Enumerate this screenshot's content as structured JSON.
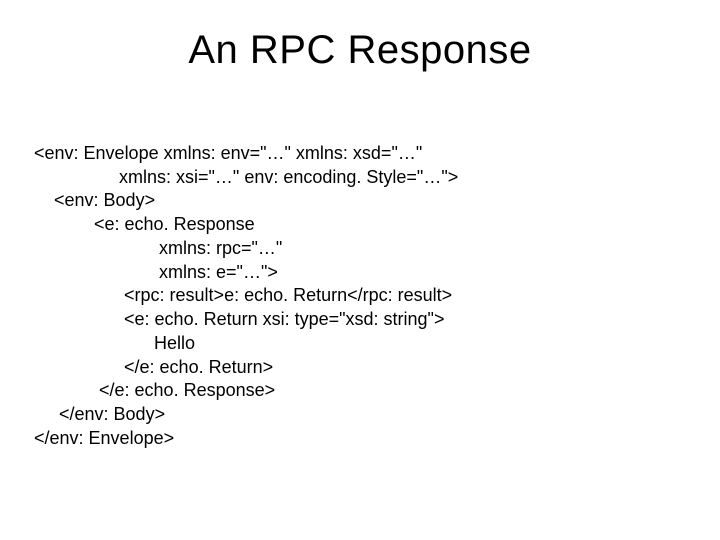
{
  "title": "An RPC Response",
  "code": {
    "l1": "<env: Envelope xmlns: env=\"…\" xmlns: xsd=\"…\"",
    "l2": "                 xmlns: xsi=\"…\" env: encoding. Style=\"…\">",
    "l3": "    <env: Body>",
    "l4": "            <e: echo. Response",
    "l5": "                         xmlns: rpc=\"…\"",
    "l6": "                         xmlns: e=\"…\">",
    "l7": "                  <rpc: result>e: echo. Return</rpc: result>",
    "l8": "                  <e: echo. Return xsi: type=\"xsd: string\">",
    "l9": "                        Hello",
    "l10": "                  </e: echo. Return>",
    "l11": "             </e: echo. Response>",
    "l12": "     </env: Body>",
    "l13": "</env: Envelope>"
  }
}
